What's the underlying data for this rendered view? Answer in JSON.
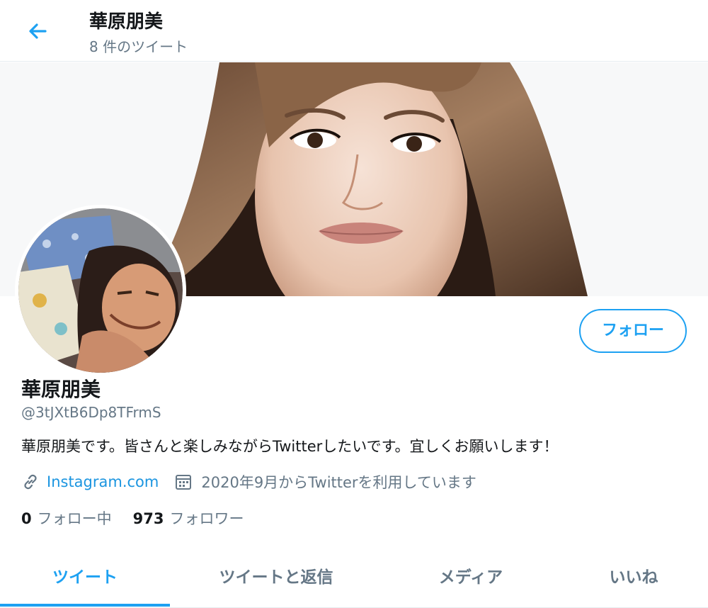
{
  "header": {
    "title": "華原朋美",
    "tweet_count": "8 件のツイート"
  },
  "profile": {
    "name": "華原朋美",
    "handle": "@3tJXtB6Dp8TFrmS",
    "bio": "華原朋美です。皆さんと楽しみながらTwitterしたいです。宜しくお願いします！",
    "link": "Instagram.com",
    "joined": "2020年9月からTwitterを利用しています",
    "following_count": "0",
    "following_label": "フォロー中",
    "followers_count": "973",
    "followers_label": "フォロワー",
    "follow_button": "フォロー"
  },
  "tabs": [
    {
      "label": "ツイート"
    },
    {
      "label": "ツイートと返信"
    },
    {
      "label": "メディア"
    },
    {
      "label": "いいね"
    }
  ],
  "colors": {
    "accent": "#1da1f2",
    "link": "#1b95e0",
    "muted": "#657786"
  },
  "icons": [
    "back-arrow-icon",
    "link-icon",
    "calendar-icon"
  ]
}
